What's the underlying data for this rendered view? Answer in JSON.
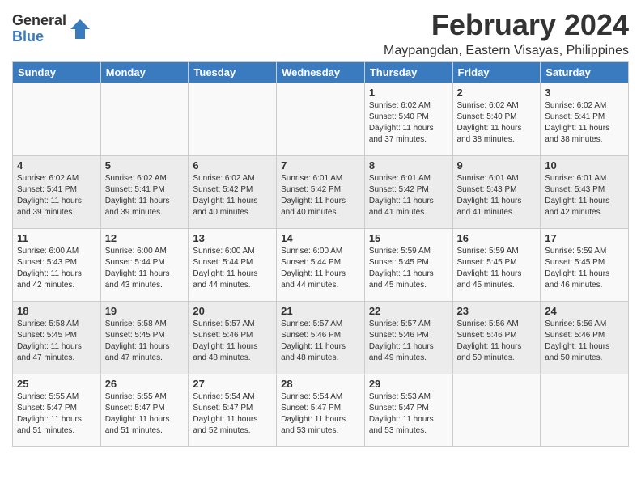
{
  "logo": {
    "general": "General",
    "blue": "Blue"
  },
  "title": "February 2024",
  "subtitle": "Maypangdan, Eastern Visayas, Philippines",
  "headers": [
    "Sunday",
    "Monday",
    "Tuesday",
    "Wednesday",
    "Thursday",
    "Friday",
    "Saturday"
  ],
  "weeks": [
    [
      {
        "day": "",
        "info": ""
      },
      {
        "day": "",
        "info": ""
      },
      {
        "day": "",
        "info": ""
      },
      {
        "day": "",
        "info": ""
      },
      {
        "day": "1",
        "info": "Sunrise: 6:02 AM\nSunset: 5:40 PM\nDaylight: 11 hours and 37 minutes."
      },
      {
        "day": "2",
        "info": "Sunrise: 6:02 AM\nSunset: 5:40 PM\nDaylight: 11 hours and 38 minutes."
      },
      {
        "day": "3",
        "info": "Sunrise: 6:02 AM\nSunset: 5:41 PM\nDaylight: 11 hours and 38 minutes."
      }
    ],
    [
      {
        "day": "4",
        "info": "Sunrise: 6:02 AM\nSunset: 5:41 PM\nDaylight: 11 hours and 39 minutes."
      },
      {
        "day": "5",
        "info": "Sunrise: 6:02 AM\nSunset: 5:41 PM\nDaylight: 11 hours and 39 minutes."
      },
      {
        "day": "6",
        "info": "Sunrise: 6:02 AM\nSunset: 5:42 PM\nDaylight: 11 hours and 40 minutes."
      },
      {
        "day": "7",
        "info": "Sunrise: 6:01 AM\nSunset: 5:42 PM\nDaylight: 11 hours and 40 minutes."
      },
      {
        "day": "8",
        "info": "Sunrise: 6:01 AM\nSunset: 5:42 PM\nDaylight: 11 hours and 41 minutes."
      },
      {
        "day": "9",
        "info": "Sunrise: 6:01 AM\nSunset: 5:43 PM\nDaylight: 11 hours and 41 minutes."
      },
      {
        "day": "10",
        "info": "Sunrise: 6:01 AM\nSunset: 5:43 PM\nDaylight: 11 hours and 42 minutes."
      }
    ],
    [
      {
        "day": "11",
        "info": "Sunrise: 6:00 AM\nSunset: 5:43 PM\nDaylight: 11 hours and 42 minutes."
      },
      {
        "day": "12",
        "info": "Sunrise: 6:00 AM\nSunset: 5:44 PM\nDaylight: 11 hours and 43 minutes."
      },
      {
        "day": "13",
        "info": "Sunrise: 6:00 AM\nSunset: 5:44 PM\nDaylight: 11 hours and 44 minutes."
      },
      {
        "day": "14",
        "info": "Sunrise: 6:00 AM\nSunset: 5:44 PM\nDaylight: 11 hours and 44 minutes."
      },
      {
        "day": "15",
        "info": "Sunrise: 5:59 AM\nSunset: 5:45 PM\nDaylight: 11 hours and 45 minutes."
      },
      {
        "day": "16",
        "info": "Sunrise: 5:59 AM\nSunset: 5:45 PM\nDaylight: 11 hours and 45 minutes."
      },
      {
        "day": "17",
        "info": "Sunrise: 5:59 AM\nSunset: 5:45 PM\nDaylight: 11 hours and 46 minutes."
      }
    ],
    [
      {
        "day": "18",
        "info": "Sunrise: 5:58 AM\nSunset: 5:45 PM\nDaylight: 11 hours and 47 minutes."
      },
      {
        "day": "19",
        "info": "Sunrise: 5:58 AM\nSunset: 5:45 PM\nDaylight: 11 hours and 47 minutes."
      },
      {
        "day": "20",
        "info": "Sunrise: 5:57 AM\nSunset: 5:46 PM\nDaylight: 11 hours and 48 minutes."
      },
      {
        "day": "21",
        "info": "Sunrise: 5:57 AM\nSunset: 5:46 PM\nDaylight: 11 hours and 48 minutes."
      },
      {
        "day": "22",
        "info": "Sunrise: 5:57 AM\nSunset: 5:46 PM\nDaylight: 11 hours and 49 minutes."
      },
      {
        "day": "23",
        "info": "Sunrise: 5:56 AM\nSunset: 5:46 PM\nDaylight: 11 hours and 50 minutes."
      },
      {
        "day": "24",
        "info": "Sunrise: 5:56 AM\nSunset: 5:46 PM\nDaylight: 11 hours and 50 minutes."
      }
    ],
    [
      {
        "day": "25",
        "info": "Sunrise: 5:55 AM\nSunset: 5:47 PM\nDaylight: 11 hours and 51 minutes."
      },
      {
        "day": "26",
        "info": "Sunrise: 5:55 AM\nSunset: 5:47 PM\nDaylight: 11 hours and 51 minutes."
      },
      {
        "day": "27",
        "info": "Sunrise: 5:54 AM\nSunset: 5:47 PM\nDaylight: 11 hours and 52 minutes."
      },
      {
        "day": "28",
        "info": "Sunrise: 5:54 AM\nSunset: 5:47 PM\nDaylight: 11 hours and 53 minutes."
      },
      {
        "day": "29",
        "info": "Sunrise: 5:53 AM\nSunset: 5:47 PM\nDaylight: 11 hours and 53 minutes."
      },
      {
        "day": "",
        "info": ""
      },
      {
        "day": "",
        "info": ""
      }
    ]
  ]
}
